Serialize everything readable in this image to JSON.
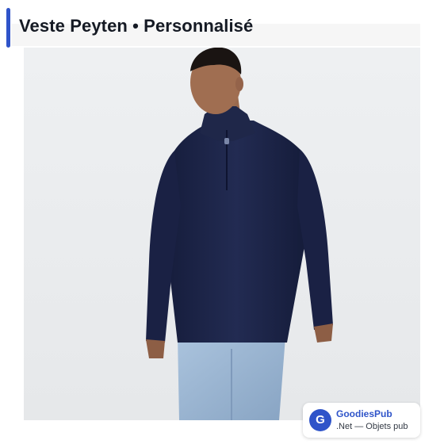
{
  "header": {
    "title": "Veste Peyten • Personnalisé"
  },
  "product": {
    "image_alt": "Veste Peyten • Personnalisé"
  },
  "brand_badge": {
    "logo_letter": "G",
    "name": "GoodiesPub",
    "tagline": ".Net — Objets pub"
  },
  "colors": {
    "accent": "#2f54c9",
    "title_text": "#151a24",
    "jacket_navy": "#1c2448",
    "photo_background": "#eceef0"
  }
}
